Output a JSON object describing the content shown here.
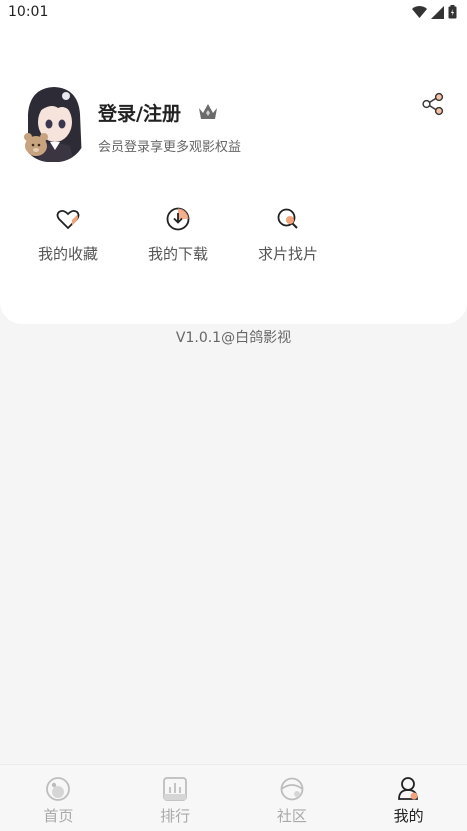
{
  "status_bar": {
    "time": "10:01"
  },
  "profile": {
    "login_label": "登录/注册",
    "subtitle": "会员登录享更多观影权益"
  },
  "actions": [
    {
      "label": "我的收藏",
      "icon": "heart-icon"
    },
    {
      "label": "我的下载",
      "icon": "download-icon"
    },
    {
      "label": "求片找片",
      "icon": "search-icon"
    }
  ],
  "version": "V1.0.1@白鸽影视",
  "tabs": [
    {
      "label": "首页",
      "icon": "home-icon",
      "active": false
    },
    {
      "label": "排行",
      "icon": "ranking-icon",
      "active": false
    },
    {
      "label": "社区",
      "icon": "community-icon",
      "active": false
    },
    {
      "label": "我的",
      "icon": "profile-icon",
      "active": true
    }
  ],
  "colors": {
    "accent": "#f2a27a",
    "active_tab": "#222222",
    "inactive_tab": "#a9a9a9"
  }
}
